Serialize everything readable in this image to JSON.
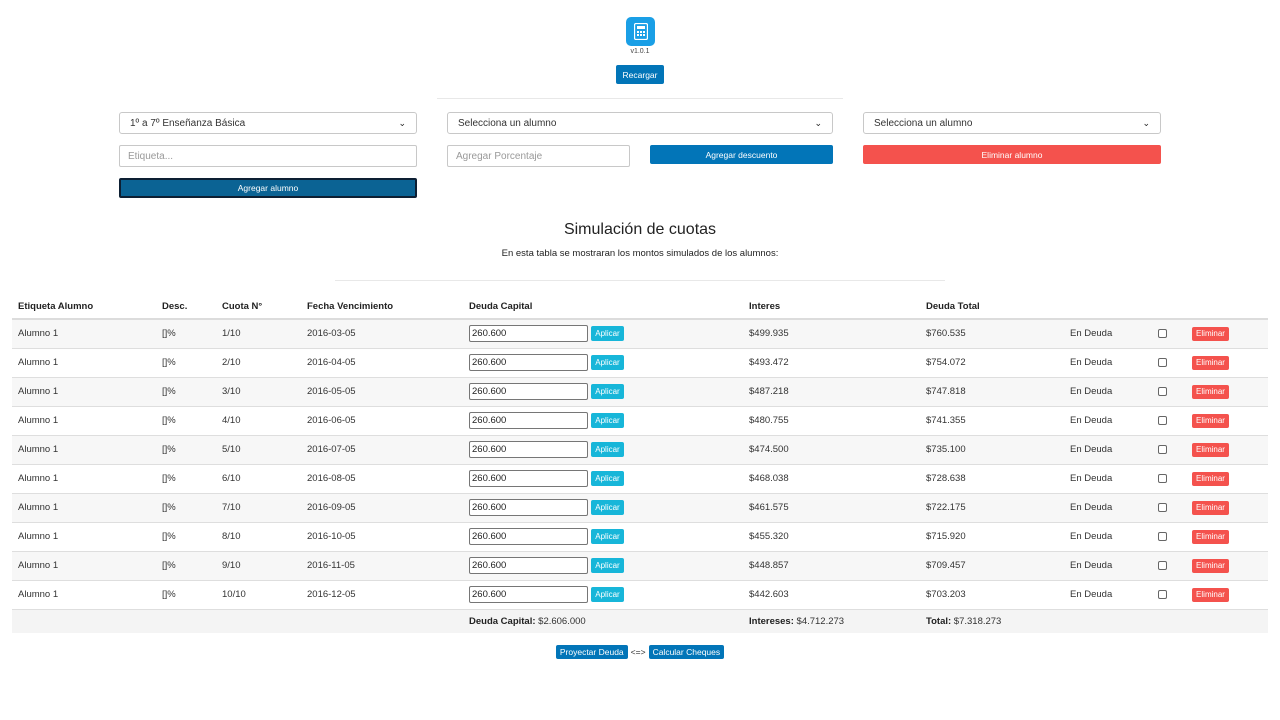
{
  "header": {
    "app_icon": "calculator-icon",
    "version": "v1.0.1",
    "reload_label": "Recargar"
  },
  "form": {
    "level_select": "1º a 7º Enseñanza Básica",
    "label_placeholder": "Etiqueta...",
    "add_student_label": "Agregar alumno",
    "student_select_1": "Selecciona un alumno",
    "percentage_placeholder": "Agregar Porcentaje",
    "add_discount_label": "Agregar descuento",
    "student_select_2": "Selecciona un alumno",
    "delete_student_label": "Eliminar alumno"
  },
  "section": {
    "title": "Simulación de cuotas",
    "subtitle": "En esta tabla se mostraran los montos simulados de los alumnos:"
  },
  "table": {
    "headers": [
      "Etiqueta Alumno",
      "Desc.",
      "Cuota N°",
      "Fecha Vencimiento",
      "Deuda Capital",
      "Interes",
      "Deuda Total"
    ],
    "apply_label": "Aplicar",
    "delete_label": "Eliminar",
    "rows": [
      {
        "student": "Alumno 1",
        "desc": "[]%",
        "cuota": "1/10",
        "fecha": "2016-03-05",
        "capital": "260.600",
        "interes": "$499.935",
        "total": "$760.535",
        "estado": "En Deuda"
      },
      {
        "student": "Alumno 1",
        "desc": "[]%",
        "cuota": "2/10",
        "fecha": "2016-04-05",
        "capital": "260.600",
        "interes": "$493.472",
        "total": "$754.072",
        "estado": "En Deuda"
      },
      {
        "student": "Alumno 1",
        "desc": "[]%",
        "cuota": "3/10",
        "fecha": "2016-05-05",
        "capital": "260.600",
        "interes": "$487.218",
        "total": "$747.818",
        "estado": "En Deuda"
      },
      {
        "student": "Alumno 1",
        "desc": "[]%",
        "cuota": "4/10",
        "fecha": "2016-06-05",
        "capital": "260.600",
        "interes": "$480.755",
        "total": "$741.355",
        "estado": "En Deuda"
      },
      {
        "student": "Alumno 1",
        "desc": "[]%",
        "cuota": "5/10",
        "fecha": "2016-07-05",
        "capital": "260.600",
        "interes": "$474.500",
        "total": "$735.100",
        "estado": "En Deuda"
      },
      {
        "student": "Alumno 1",
        "desc": "[]%",
        "cuota": "6/10",
        "fecha": "2016-08-05",
        "capital": "260.600",
        "interes": "$468.038",
        "total": "$728.638",
        "estado": "En Deuda"
      },
      {
        "student": "Alumno 1",
        "desc": "[]%",
        "cuota": "7/10",
        "fecha": "2016-09-05",
        "capital": "260.600",
        "interes": "$461.575",
        "total": "$722.175",
        "estado": "En Deuda"
      },
      {
        "student": "Alumno 1",
        "desc": "[]%",
        "cuota": "8/10",
        "fecha": "2016-10-05",
        "capital": "260.600",
        "interes": "$455.320",
        "total": "$715.920",
        "estado": "En Deuda"
      },
      {
        "student": "Alumno 1",
        "desc": "[]%",
        "cuota": "9/10",
        "fecha": "2016-11-05",
        "capital": "260.600",
        "interes": "$448.857",
        "total": "$709.457",
        "estado": "En Deuda"
      },
      {
        "student": "Alumno 1",
        "desc": "[]%",
        "cuota": "10/10",
        "fecha": "2016-12-05",
        "capital": "260.600",
        "interes": "$442.603",
        "total": "$703.203",
        "estado": "En Deuda"
      }
    ],
    "footer": {
      "capital_label": "Deuda Capital:",
      "capital_value": "$2.606.000",
      "interes_label": "Intereses:",
      "interes_value": "$4.712.273",
      "total_label": "Total:",
      "total_value": "$7.318.273"
    }
  },
  "actions": {
    "project_label": "Proyectar Deuda",
    "separator": "<=>",
    "checks_label": "Calcular Cheques"
  }
}
